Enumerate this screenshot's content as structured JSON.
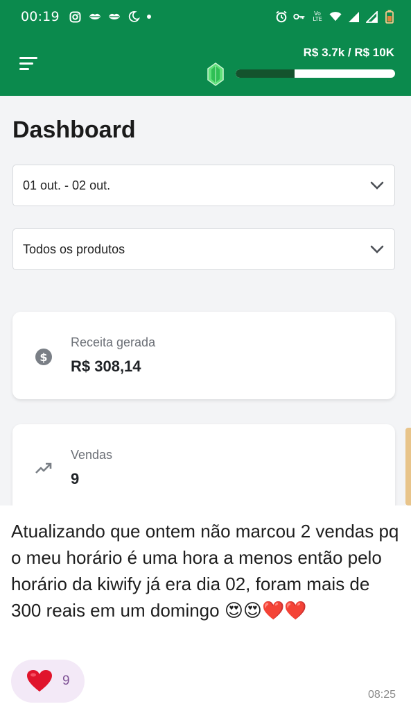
{
  "status_bar": {
    "time": "00:19",
    "network_label_top": "Vo",
    "network_label_bottom": "LTE"
  },
  "app_bar": {
    "goal_text": "R$ 3.7k / R$ 10K",
    "goal_progress_fraction": 0.37
  },
  "page": {
    "title": "Dashboard",
    "date_filter": "01 out. - 02 out.",
    "product_filter": "Todos os produtos"
  },
  "cards": {
    "revenue": {
      "label": "Receita gerada",
      "value": "R$ 308,14",
      "icon": "dollar-circle-icon"
    },
    "sales": {
      "label": "Vendas",
      "value": "9",
      "icon": "trending-up-icon"
    }
  },
  "message": {
    "text": "Atualizando que ontem não marcou 2 vendas pq o meu horário é uma hora a menos então pelo horário da kiwify já era dia 02, foram mais de 300 reais em um domingo 😍😍❤️❤️",
    "reaction_emoji": "❤️",
    "reaction_count": "9",
    "time": "08:25"
  },
  "colors": {
    "brand_green": "#0b8a4d",
    "progress_fill": "#14532d",
    "reaction_bg": "#f3e9f7"
  }
}
